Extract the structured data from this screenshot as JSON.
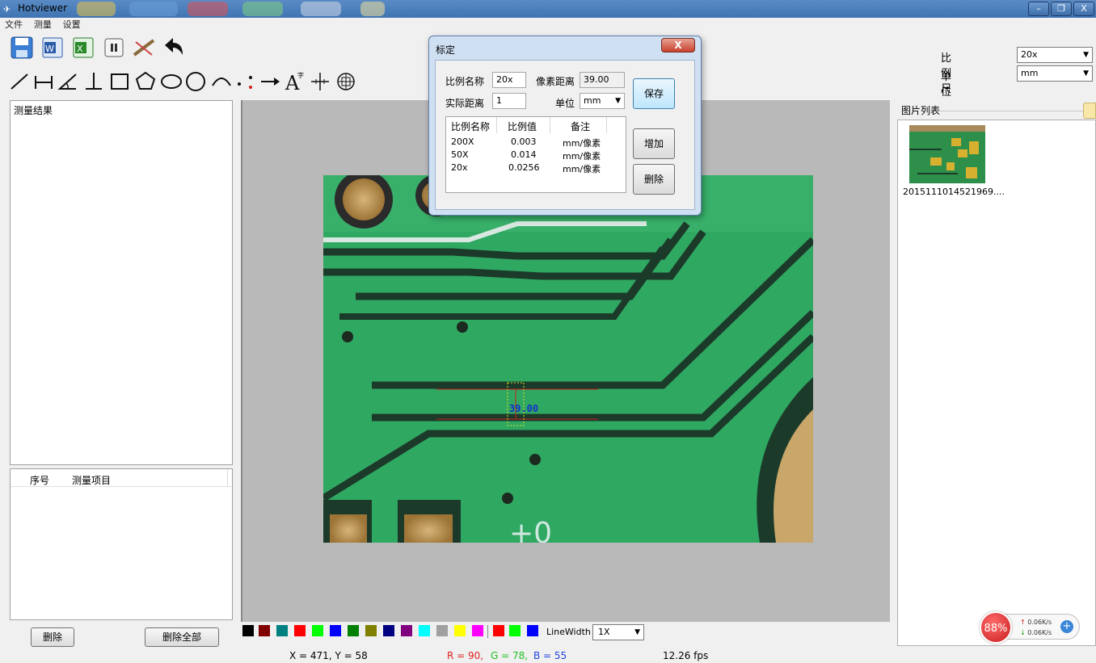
{
  "window": {
    "title": "Hotviewer",
    "controls": [
      "–",
      "❐",
      "X"
    ]
  },
  "menu": [
    "文件",
    "测量",
    "设置"
  ],
  "toolbar": {
    "icons": [
      "save-icon",
      "word-export-icon",
      "excel-export-icon",
      "pause-icon",
      "clear-icon",
      "undo-icon"
    ],
    "draw_tools": [
      "line-tool",
      "dimension-tool",
      "angle-tool",
      "perpendicular-tool",
      "rectangle-tool",
      "polygon-tool",
      "ellipse-tool",
      "circle-tool",
      "arc-tool",
      "point-tool",
      "arrow-tool",
      "text-tool",
      "crosshair-tool",
      "target-tool"
    ]
  },
  "scale_panel": {
    "scale_label": "比例尺",
    "scale_value": "20x",
    "unit_label": "单位",
    "unit_value": "mm"
  },
  "left": {
    "results_header": "测量结果",
    "items_col_index": "序号",
    "items_col_name": "测量项目",
    "delete_button": "删除",
    "delete_all_button": "删除全部"
  },
  "canvas": {
    "measurement_label": "39.00"
  },
  "palette": {
    "colors": [
      "#000000",
      "#800000",
      "#008080",
      "#ff0000",
      "#00ff00",
      "#0000ff",
      "#008000",
      "#808000",
      "#000080",
      "#800080",
      "#00ffff",
      "#a0a0a0",
      "#ffff00",
      "#ff00ff",
      "#ff0000",
      "#00ff00",
      "#0000ff"
    ],
    "line_width_label": "LineWidth",
    "line_width_value": "1X"
  },
  "status": {
    "coords": "X = 471, Y = 58",
    "r": "R = 90,",
    "g": "G = 78,",
    "b": "B = 55",
    "fps": "12.26 fps"
  },
  "picture_list": {
    "label": "图片列表",
    "items": [
      {
        "caption": "2015111014521969...."
      }
    ]
  },
  "net_widget": {
    "percent": "88%",
    "up": "0.06K/s",
    "down": "0.06K/s"
  },
  "dialog": {
    "title": "标定",
    "close": "X",
    "name_label": "比例名称",
    "name_value": "20x",
    "pixel_label": "像素距离",
    "pixel_value": "39.00",
    "actual_label": "实际距离",
    "actual_value": "1",
    "unit_label": "单位",
    "unit_value": "mm",
    "save_button": "保存",
    "add_button": "增加",
    "delete_button": "删除",
    "table": {
      "headers": [
        "比例名称",
        "比例值",
        "备注"
      ],
      "rows": [
        {
          "name": "200X",
          "value": "0.003",
          "note": "mm/像素"
        },
        {
          "name": "50X",
          "value": "0.014",
          "note": "mm/像素"
        },
        {
          "name": "20x",
          "value": "0.0256",
          "note": "mm/像素"
        }
      ]
    }
  }
}
